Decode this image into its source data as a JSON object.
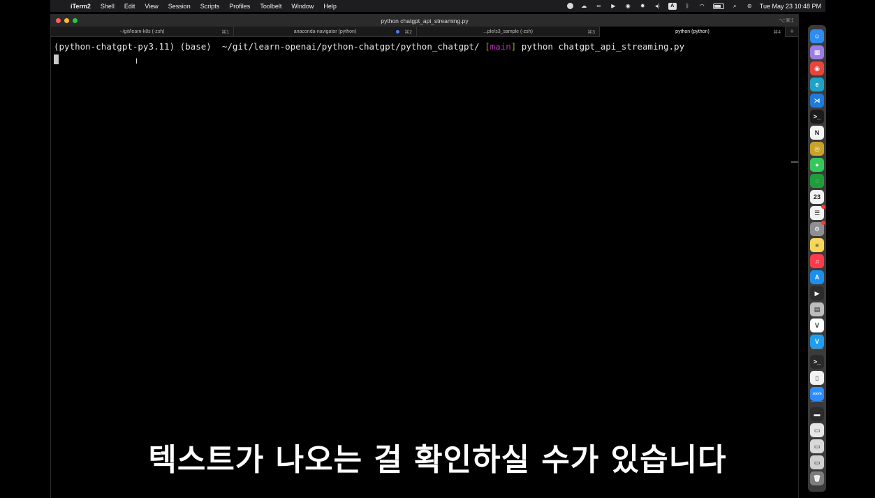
{
  "menubar": {
    "app_name": "iTerm2",
    "items": [
      "Shell",
      "Edit",
      "View",
      "Session",
      "Scripts",
      "Profiles",
      "Toolbelt",
      "Window",
      "Help"
    ],
    "status_icons": [
      "minus-circle-icon",
      "cloud-icon",
      "glasses-icon",
      "play-icon",
      "record-icon",
      "brightness-icon",
      "volume-icon",
      "input-source-icon",
      "bluetooth-icon",
      "wifi-icon",
      "battery-icon",
      "search-icon",
      "control-center-icon"
    ],
    "input_source_letter": "A",
    "clock": "Tue May 23  10:48 PM"
  },
  "window": {
    "title": "python chatgpt_api_streaming.py",
    "title_shortcut": "⌥⌘1",
    "tabs": [
      {
        "label": "~/git/learn-k8s (-zsh)",
        "key": "⌘1",
        "active": false,
        "dot": false
      },
      {
        "label": "anaconda-navigator (python)",
        "key": "⌘2",
        "active": false,
        "dot": true
      },
      {
        "label": "...ple/s3_sample (-zsh)",
        "key": "⌘3",
        "active": false,
        "dot": false
      },
      {
        "label": "python (python)",
        "key": "⌘4",
        "active": true,
        "dot": false
      }
    ],
    "new_tab_label": "+"
  },
  "terminal": {
    "env": "(python-chatgpt-py3.11) (base) ",
    "apple_glyph": "",
    "path": " ~/git/learn-openai/python-chatgpt/python_chatgpt/ ",
    "branch_open": "[",
    "branch": "main",
    "branch_close": "]",
    "command": " python chatgpt_api_streaming.py"
  },
  "subtitle": "텍스트가 나오는 걸 확인하실 수가 있습니다",
  "dock": {
    "items": [
      {
        "name": "finder-icon",
        "color": "#2f8cf0",
        "glyph": "☺"
      },
      {
        "name": "launchpad-icon",
        "color": "#9a7de0",
        "glyph": "▦"
      },
      {
        "name": "chrome-icon",
        "color": "#e8453c",
        "glyph": "◉"
      },
      {
        "name": "edge-icon",
        "color": "#1fa2c8",
        "glyph": "e"
      },
      {
        "name": "vscode-icon",
        "color": "#1f7ad9",
        "glyph": "⋊"
      },
      {
        "name": "iterm-icon",
        "color": "#1b1b1b",
        "glyph": ">_"
      },
      {
        "name": "notion-icon",
        "color": "#f4f4f4",
        "glyph": "N"
      },
      {
        "name": "db-icon",
        "color": "#c9a227",
        "glyph": "◎"
      },
      {
        "name": "messages-icon",
        "color": "#34c759",
        "glyph": "●"
      },
      {
        "name": "activity-icon",
        "color": "#1f9d3a",
        "glyph": "◌"
      },
      {
        "name": "calendar-icon",
        "color": "#f2f2f2",
        "glyph": "23"
      },
      {
        "name": "reminders-icon",
        "color": "#f2f2f2",
        "glyph": "☰"
      },
      {
        "name": "settings-icon",
        "color": "#8e8e93",
        "glyph": "⚙"
      },
      {
        "name": "notes-icon",
        "color": "#f7d75a",
        "glyph": "≡"
      },
      {
        "name": "music-icon",
        "color": "#fa3c4c",
        "glyph": "♫"
      },
      {
        "name": "appstore-icon",
        "color": "#1c8ef0",
        "glyph": "A"
      },
      {
        "name": "finalcut-icon",
        "color": "#2c2c2c",
        "glyph": "▶"
      },
      {
        "name": "sequel-icon",
        "color": "#bdbdbd",
        "glyph": "▤"
      },
      {
        "name": "vim-icon",
        "color": "#ffffff",
        "glyph": "V"
      },
      {
        "name": "vivid-icon",
        "color": "#1f9ef0",
        "glyph": "V"
      },
      {
        "name": "terminal-icon",
        "color": "#2a2a2a",
        "glyph": ">_"
      },
      {
        "name": "document-icon",
        "color": "#f2f2f2",
        "glyph": "▯"
      },
      {
        "name": "zoom-icon",
        "color": "#2d8cff",
        "glyph": "zoom"
      },
      {
        "name": "window-thumb-icon",
        "color": "#2c2c2c",
        "glyph": "▬"
      },
      {
        "name": "window-thumb2-icon",
        "color": "#e6e6e6",
        "glyph": "▭"
      },
      {
        "name": "window-thumb3-icon",
        "color": "#d9d9d9",
        "glyph": "▭"
      },
      {
        "name": "window-thumb4-icon",
        "color": "#cfcfcf",
        "glyph": "▭"
      },
      {
        "name": "trash-icon",
        "color": "#7d7d7d",
        "glyph": "🗑"
      }
    ],
    "badged": [
      "reminders-icon",
      "settings-icon"
    ]
  }
}
